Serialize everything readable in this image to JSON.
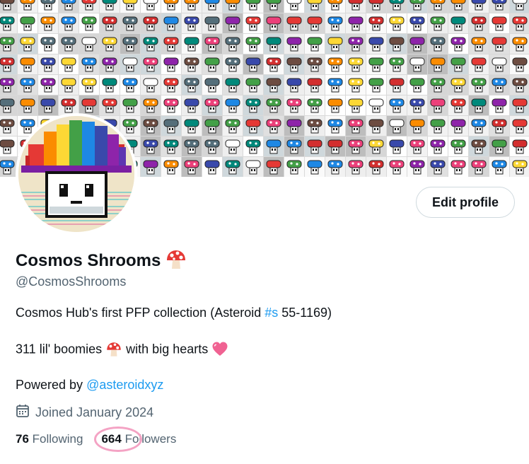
{
  "banner": {
    "icon": "mushroom-collage"
  },
  "avatar": {
    "icon": "rainbow-pixel-mushroom"
  },
  "profile": {
    "edit_button": "Edit profile",
    "display_name": "Cosmos Shrooms",
    "name_emoji": "mushroom-emoji",
    "handle": "@CosmosShrooms",
    "bio": {
      "line1_prefix": "Cosmos Hub's first PFP collection (Asteroid ",
      "line1_hashtag": "#s",
      "line1_suffix": " 55-1169)",
      "line2_prefix": "311 lil' boomies ",
      "line2_middle": " with big hearts ",
      "line3_prefix": "Powered by ",
      "line3_mention": "@asteroidxyz"
    },
    "joined": "Joined January 2024",
    "following_count": "76",
    "following_label": "Following",
    "followers_count": "664",
    "followers_label": "Followers"
  },
  "colors": {
    "link": "#1d9bf0",
    "secondary_text": "#536471",
    "highlight_circle": "#f4a3c4"
  }
}
